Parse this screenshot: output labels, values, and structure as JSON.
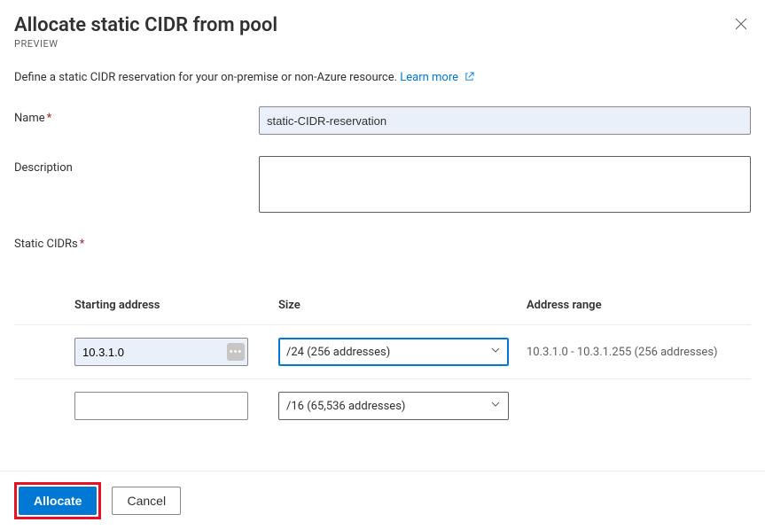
{
  "header": {
    "title": "Allocate static CIDR from pool",
    "preview_label": "PREVIEW"
  },
  "intro": {
    "text": "Define a static CIDR reservation for your on-premise or non-Azure resource.",
    "learn_more_label": "Learn more"
  },
  "form": {
    "name": {
      "label": "Name",
      "value": "static-CIDR-reservation"
    },
    "description": {
      "label": "Description",
      "value": ""
    },
    "static_cidrs_label": "Static CIDRs"
  },
  "table": {
    "headers": {
      "starting_address": "Starting address",
      "size": "Size",
      "address_range": "Address range"
    },
    "rows": [
      {
        "starting_address": "10.3.1.0",
        "size": "/24 (256 addresses)",
        "address_range": "10.3.1.0 - 10.3.1.255 (256 addresses)",
        "focused": true,
        "has_more": true
      },
      {
        "starting_address": "",
        "size": "/16 (65,536 addresses)",
        "address_range": "",
        "focused": false,
        "has_more": false
      }
    ]
  },
  "footer": {
    "allocate_label": "Allocate",
    "cancel_label": "Cancel"
  }
}
